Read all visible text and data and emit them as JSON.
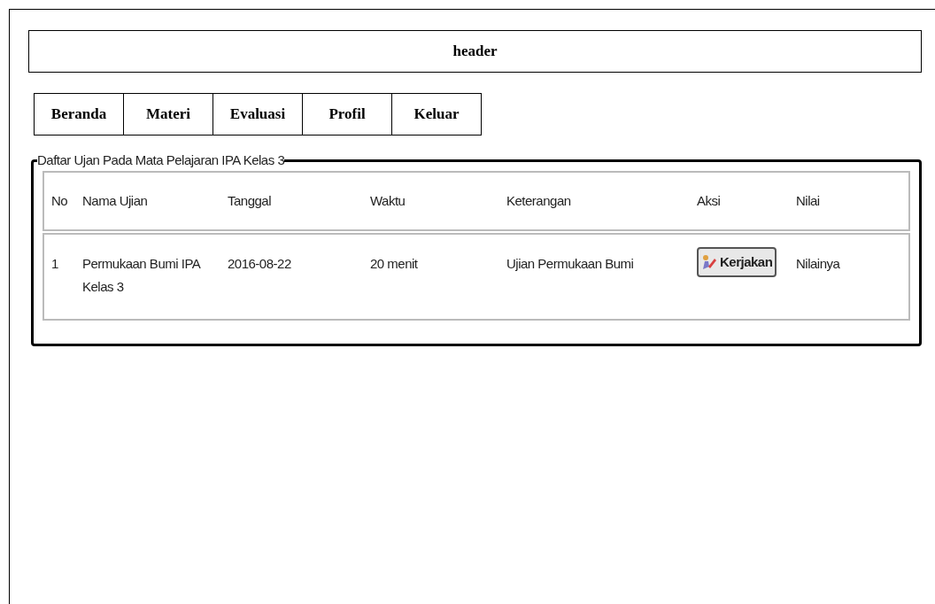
{
  "header": {
    "title": "header"
  },
  "nav": [
    {
      "label": "Beranda"
    },
    {
      "label": "Materi"
    },
    {
      "label": "Evaluasi"
    },
    {
      "label": "Profil"
    },
    {
      "label": "Keluar"
    }
  ],
  "exam_list": {
    "legend": "Daftar Ujan Pada Mata Pelajaran IPA Kelas 3",
    "columns": [
      "No",
      "Nama Ujian",
      "Tanggal",
      "Waktu",
      "Keterangan",
      "Aksi",
      "Nilai"
    ],
    "rows": [
      {
        "no": "1",
        "name": "Permukaan Bumi IPA Kelas 3",
        "date": "2016-08-22",
        "duration": "20 menit",
        "note": "Ujian Permukaan Bumi",
        "action": "Kerjakan",
        "score": "Nilainya"
      }
    ]
  }
}
